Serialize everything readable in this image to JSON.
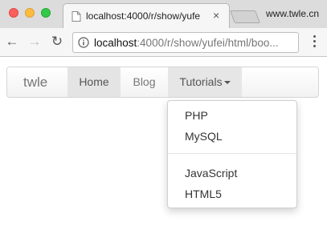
{
  "browser": {
    "tab": {
      "title": "localhost:4000/r/show/yufe",
      "close_glyph": "×"
    },
    "profile_label": "www.twle.cn",
    "nav": {
      "back_glyph": "←",
      "forward_glyph": "→",
      "reload_glyph": "↻"
    },
    "address": {
      "host": "localhost",
      "rest": ":4000/r/show/yufei/html/boo..."
    }
  },
  "page": {
    "navbar": {
      "brand": "twle",
      "items": [
        {
          "label": "Home",
          "active": true
        },
        {
          "label": "Blog",
          "active": false
        },
        {
          "label": "Tutorials",
          "dropdown": true,
          "open": true
        }
      ]
    },
    "dropdown": {
      "group1": [
        "PHP",
        "MySQL"
      ],
      "group2": [
        "JavaScript",
        "HTML5"
      ]
    }
  }
}
